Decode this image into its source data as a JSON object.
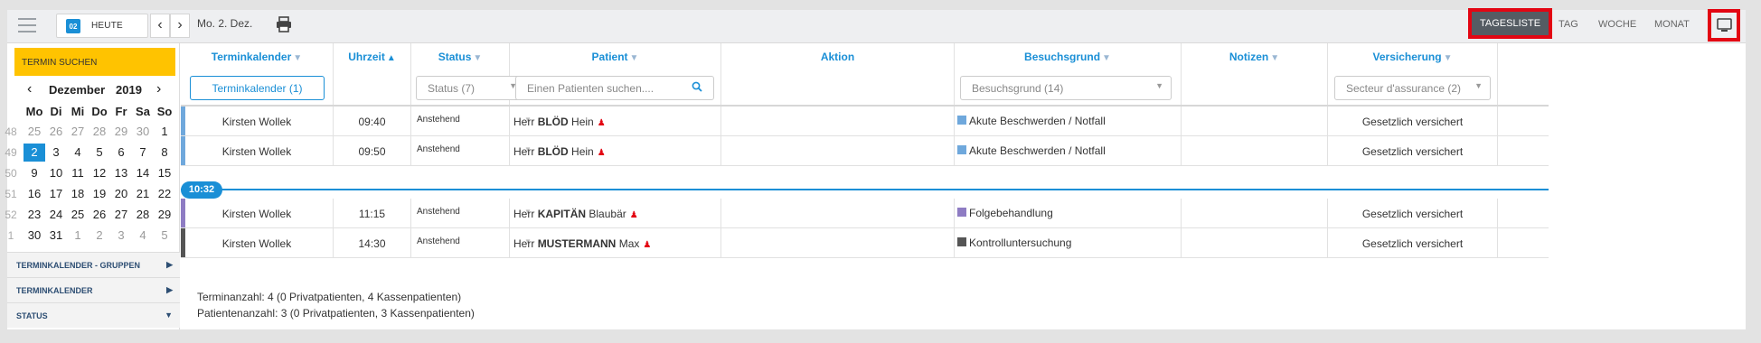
{
  "toolbar": {
    "today_icon_day": "02",
    "today_label": "HEUTE",
    "prev_arrow": "‹",
    "next_arrow": "›",
    "date": "Mo. 2. Dez.",
    "views": [
      "TAGESLISTE",
      "TAG",
      "WOCHE",
      "MONAT"
    ],
    "active_view": "TAGESLISTE",
    "highlight_color": "#e30613"
  },
  "sidebar": {
    "search_button": "TERMIN SUCHEN",
    "calendar": {
      "month": "Dezember",
      "year": "2019",
      "weekdays": [
        "Mo",
        "Di",
        "Mi",
        "Do",
        "Fr",
        "Sa",
        "So"
      ],
      "weeks": [
        {
          "nr": "48",
          "days": [
            "25",
            "26",
            "27",
            "28",
            "29",
            "30",
            "1"
          ]
        },
        {
          "nr": "49",
          "days": [
            "2",
            "3",
            "4",
            "5",
            "6",
            "7",
            "8"
          ]
        },
        {
          "nr": "50",
          "days": [
            "9",
            "10",
            "11",
            "12",
            "13",
            "14",
            "15"
          ]
        },
        {
          "nr": "51",
          "days": [
            "16",
            "17",
            "18",
            "19",
            "20",
            "21",
            "22"
          ]
        },
        {
          "nr": "52",
          "days": [
            "23",
            "24",
            "25",
            "26",
            "27",
            "28",
            "29"
          ]
        },
        {
          "nr": "1",
          "days": [
            "30",
            "31",
            "1",
            "2",
            "3",
            "4",
            "5"
          ]
        }
      ],
      "selected_day": "2"
    },
    "sections": [
      "TERMINKALENDER - GRUPPEN",
      "TERMINKALENDER",
      "STATUS"
    ]
  },
  "table": {
    "columns": [
      "Terminkalender",
      "Uhrzeit",
      "Status",
      "Patient",
      "Aktion",
      "Besuchsgrund",
      "Notizen",
      "Versicherung"
    ],
    "filters": {
      "terminkalender": "Terminkalender (1)",
      "status": "Status (7)",
      "patient_placeholder": "Einen Patienten suchen....",
      "besuchsgrund": "Besuchsgrund (14)",
      "versicherung": "Secteur d'assurance (2)"
    },
    "current_time": "10:32",
    "rows": [
      {
        "calendar": "Kirsten Wollek",
        "time": "09:40",
        "status": "Anstehend",
        "salutation": "Herr",
        "lastname": "BLÖD",
        "firstname": "Hein",
        "reason": "Akute Beschwerden / Notfall",
        "reason_color": "#6fa8dc",
        "bar_color": "#6fa8dc",
        "insurance": "Gesetzlich versichert"
      },
      {
        "calendar": "Kirsten Wollek",
        "time": "09:50",
        "status": "Anstehend",
        "salutation": "Herr",
        "lastname": "BLÖD",
        "firstname": "Hein",
        "reason": "Akute Beschwerden / Notfall",
        "reason_color": "#6fa8dc",
        "bar_color": "#6fa8dc",
        "insurance": "Gesetzlich versichert"
      },
      {
        "calendar": "Kirsten Wollek",
        "time": "11:15",
        "status": "Anstehend",
        "salutation": "Herr",
        "lastname": "KAPITÄN",
        "firstname": "Blaubär",
        "reason": "Folgebehandlung",
        "reason_color": "#8e7cc3",
        "bar_color": "#8e7cc3",
        "insurance": "Gesetzlich versichert"
      },
      {
        "calendar": "Kirsten Wollek",
        "time": "14:30",
        "status": "Anstehend",
        "salutation": "Herr",
        "lastname": "MUSTERMANN",
        "firstname": "Max",
        "reason": "Kontrolluntersuchung",
        "reason_color": "#555555",
        "bar_color": "#555555",
        "insurance": "Gesetzlich versichert"
      }
    ]
  },
  "summary": {
    "appointments": "Terminanzahl: 4 (0 Privatpatienten, 4 Kassenpatienten)",
    "patients": "Patientenanzahl: 3 (0 Privatpatienten, 3 Kassenpatienten)"
  }
}
